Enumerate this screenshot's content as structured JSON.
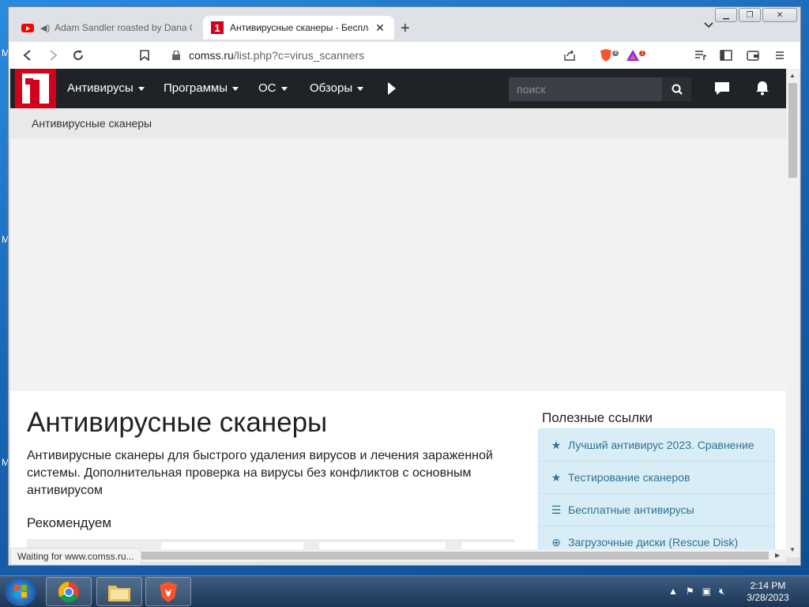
{
  "desktop": {
    "left_letters": [
      "M",
      "M",
      "M"
    ]
  },
  "browser": {
    "tabs": [
      {
        "title": "Adam Sandler roasted by Dana Carvey",
        "active": false,
        "audio": true
      },
      {
        "title": "Антивирусные сканеры - Бесплатные",
        "active": true,
        "audio": false
      }
    ],
    "new_tab_symbol": "+",
    "url": {
      "host": "comss.ru",
      "path": "/list.php?c=virus_scanners"
    },
    "brave_shield_count": "4",
    "rewards_count": "1",
    "status_text": "Waiting for www.comss.ru..."
  },
  "site": {
    "nav": [
      {
        "label": "Антивирусы",
        "dropdown": true
      },
      {
        "label": "Программы",
        "dropdown": true
      },
      {
        "label": "ОС",
        "dropdown": true
      },
      {
        "label": "Обзоры",
        "dropdown": true
      }
    ],
    "search_placeholder": "поиск",
    "breadcrumb": "Антивирусные сканеры",
    "page_title": "Антивирусные сканеры",
    "description": "Антивирусные сканеры для быстрого удаления вирусов и лечения зараженной системы. Дополнительная проверка на вирусы без конфликтов с основным антивирусом",
    "recommend_heading": "Рекомендуем",
    "useful_links_title": "Полезные ссылки",
    "useful_links": [
      {
        "icon": "star-icon",
        "label": "Лучший антивирус 2023. Сравнение"
      },
      {
        "icon": "star-icon",
        "label": "Тестирование сканеров"
      },
      {
        "icon": "list-icon",
        "label": "Бесплатные антивирусы"
      },
      {
        "icon": "plus-circle-icon",
        "label": "Загрузочные диски (Rescue Disk)"
      }
    ]
  },
  "taskbar": {
    "time": "2:14 PM",
    "date": "3/28/2023"
  }
}
